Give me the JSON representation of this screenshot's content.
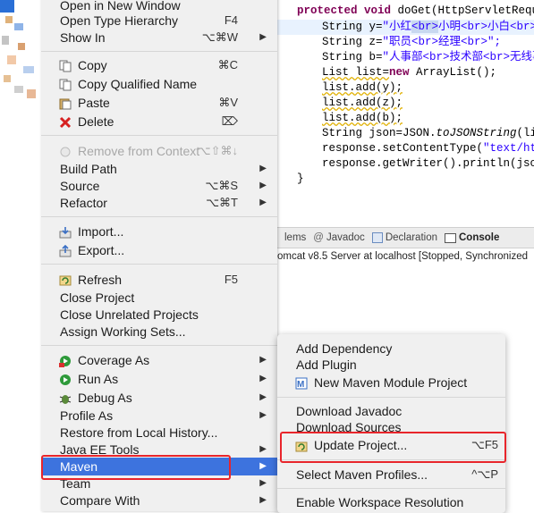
{
  "menu": {
    "items": [
      {
        "id": "open-new-window",
        "label": "Open in New Window"
      },
      {
        "id": "open-type-hierarchy",
        "label": "Open Type Hierarchy",
        "shortcut": "F4"
      },
      {
        "id": "show-in",
        "label": "Show In",
        "shortcut": "⌥⌘W",
        "submenu": true
      },
      {
        "id": "copy",
        "label": "Copy",
        "shortcut": "⌘C",
        "icon": "copy-icon"
      },
      {
        "id": "copy-qualified-name",
        "label": "Copy Qualified Name",
        "icon": "copy-icon"
      },
      {
        "id": "paste",
        "label": "Paste",
        "shortcut": "⌘V",
        "icon": "paste-icon"
      },
      {
        "id": "delete",
        "label": "Delete",
        "shortcut": "⌦",
        "icon": "delete-icon"
      },
      {
        "id": "remove-from-context",
        "label": "Remove from Context",
        "shortcut": "⌥⇧⌘↓",
        "icon": "remove-context-icon",
        "disabled": true
      },
      {
        "id": "build-path",
        "label": "Build Path",
        "submenu": true
      },
      {
        "id": "source",
        "label": "Source",
        "shortcut": "⌥⌘S",
        "submenu": true
      },
      {
        "id": "refactor",
        "label": "Refactor",
        "shortcut": "⌥⌘T",
        "submenu": true
      },
      {
        "id": "import",
        "label": "Import...",
        "icon": "import-icon"
      },
      {
        "id": "export",
        "label": "Export...",
        "icon": "export-icon"
      },
      {
        "id": "refresh",
        "label": "Refresh",
        "shortcut": "F5",
        "icon": "refresh-icon"
      },
      {
        "id": "close-project",
        "label": "Close Project"
      },
      {
        "id": "close-unrelated-projects",
        "label": "Close Unrelated Projects"
      },
      {
        "id": "assign-working-sets",
        "label": "Assign Working Sets..."
      },
      {
        "id": "coverage-as",
        "label": "Coverage As",
        "submenu": true,
        "icon": "coverage-icon"
      },
      {
        "id": "run-as",
        "label": "Run As",
        "submenu": true,
        "icon": "run-icon"
      },
      {
        "id": "debug-as",
        "label": "Debug As",
        "submenu": true,
        "icon": "debug-icon"
      },
      {
        "id": "profile-as",
        "label": "Profile As",
        "submenu": true
      },
      {
        "id": "restore-local-history",
        "label": "Restore from Local History..."
      },
      {
        "id": "java-ee-tools",
        "label": "Java EE Tools",
        "submenu": true
      },
      {
        "id": "maven",
        "label": "Maven",
        "submenu": true,
        "selected": true
      },
      {
        "id": "team",
        "label": "Team",
        "submenu": true
      },
      {
        "id": "compare-with",
        "label": "Compare With",
        "submenu": true
      }
    ]
  },
  "submenu": {
    "items": [
      {
        "id": "add-dependency",
        "label": "Add Dependency"
      },
      {
        "id": "add-plugin",
        "label": "Add Plugin"
      },
      {
        "id": "new-maven-module",
        "label": "New Maven Module Project",
        "icon": "maven-module-icon"
      },
      {
        "id": "download-javadoc",
        "label": "Download Javadoc"
      },
      {
        "id": "download-sources",
        "label": "Download Sources"
      },
      {
        "id": "update-project",
        "label": "Update Project...",
        "shortcut": "⌥F5",
        "icon": "update-project-icon"
      },
      {
        "id": "select-maven-profiles",
        "label": "Select Maven Profiles...",
        "shortcut": "^⌥P"
      },
      {
        "id": "enable-workspace-resolution",
        "label": "Enable Workspace Resolution"
      }
    ]
  },
  "editor": {
    "signature": {
      "kw": "protected void ",
      "rest": "doGet(HttpServletReque"
    },
    "lines": {
      "y_decl": "String y=",
      "y_str_a": "\"小红",
      "y_str_b": "<br>",
      "y_str_c": "小明<br>小白<br>\";",
      "z_decl": "String z=",
      "z_str": "\"职员<br>经理<br>\";",
      "b_decl": "String b=",
      "b_str": "\"人事部<br>技术部<br>无线事",
      "list_a": "List list=",
      "list_kw": "new",
      "list_b": " ArrayList();",
      "add_y": "list.add(y);",
      "add_z": "list.add(z);",
      "add_b": "list.add(b);",
      "json_a": "String json=JSON.",
      "json_b": "toJSONString",
      "json_c": "(lis",
      "ct_a": "response.setContentType(",
      "ct_b": "\"text/htm",
      "wr": "response.getWriter().println(json",
      "brace": "}"
    }
  },
  "views": {
    "tabs": [
      {
        "id": "problems",
        "label": "lems"
      },
      {
        "id": "javadoc",
        "label": "Javadoc",
        "icon": "at-icon"
      },
      {
        "id": "declaration",
        "label": "Declaration",
        "icon": "declaration-icon"
      },
      {
        "id": "console",
        "label": "Console",
        "icon": "console-icon",
        "active": true
      }
    ],
    "console_text": "omcat v8.5 Server at localhost [Stopped, Synchronized"
  },
  "colors": {
    "selection": "#3d73de",
    "highlight_box": "#e8252b",
    "keyword": "#7f0055",
    "string": "#2a00ff"
  }
}
